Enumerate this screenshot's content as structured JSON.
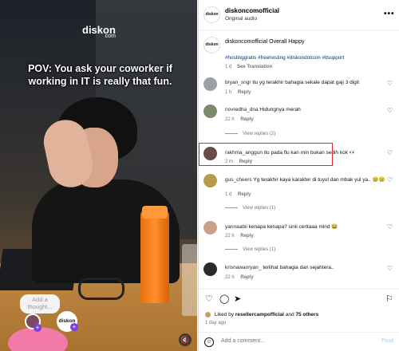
{
  "media": {
    "logo_text": "diskon",
    "logo_small": "com",
    "caption": "POV: You ask your coworker if working in IT is really that fun.",
    "thought_placeholder": "Add a thought...",
    "logo_badge": "diskon",
    "plus": "+",
    "mute_icon": "🔇"
  },
  "header": {
    "username": "diskoncomofficial",
    "audio": "Original audio",
    "avatar_text": "diskon",
    "more": "•••"
  },
  "post": {
    "avatar_text": "diskon",
    "title": "diskoncomofficial Overall Happy",
    "hashtags": "#hostinggratis #freehosting #diskondotcom #itsupport",
    "time": "1 d",
    "translation": "See Translation"
  },
  "comments": [
    {
      "user": "bryan_sngr",
      "text": "itu yg terakhir bahagia sekale dapat gaji 3 digit",
      "time": "1 h",
      "reply": "Reply",
      "color": "#9aa0a6"
    },
    {
      "user": "novredha_dna",
      "text": "Hidungnya merah",
      "time": "22 h",
      "reply": "Reply",
      "color": "#7a8a6a",
      "view_replies": "View replies (2)"
    },
    {
      "user": "rakhma_anggun",
      "text": "itu pada flu kan min bukan sedih kok 👀",
      "time": "2 m",
      "reply": "Reply",
      "color": "#6a4a4a"
    },
    {
      "user": "gus_cheers",
      "text": "Yg terakhir kaya karakter di tuyul dan mbak yul ya.. 😢😢",
      "time": "1 d",
      "reply": "Reply",
      "color": "#b89b4a",
      "view_replies": "View replies (1)"
    },
    {
      "user": "yannaabii",
      "text": "kenapa kenapa? sinii ceritaaa mind 😂",
      "time": "22 h",
      "reply": "Reply",
      "color": "#c9a08a",
      "view_replies": "View replies (1)"
    },
    {
      "user": "krisnawanryan_",
      "text": "terlihat bahagia dan sejahtera..",
      "time": "22 h",
      "reply": "Reply",
      "color": "#2a2a2a"
    }
  ],
  "actions": {
    "like_icon": "♡",
    "comment_icon": "◯",
    "share_icon": "➤",
    "save_icon": "⚐",
    "liked_by_prefix": "Liked by",
    "liked_by_user": "resellercampofficial",
    "liked_by_and": "and",
    "liked_by_others": "75 others",
    "ago": "1 day ago",
    "emoji_icon": "☺",
    "comment_placeholder": "Add a comment...",
    "post_button": "Post"
  },
  "colors": {
    "highlight": "#e2262b",
    "hashtag": "#00376b",
    "post_button": "#b3dbff"
  }
}
